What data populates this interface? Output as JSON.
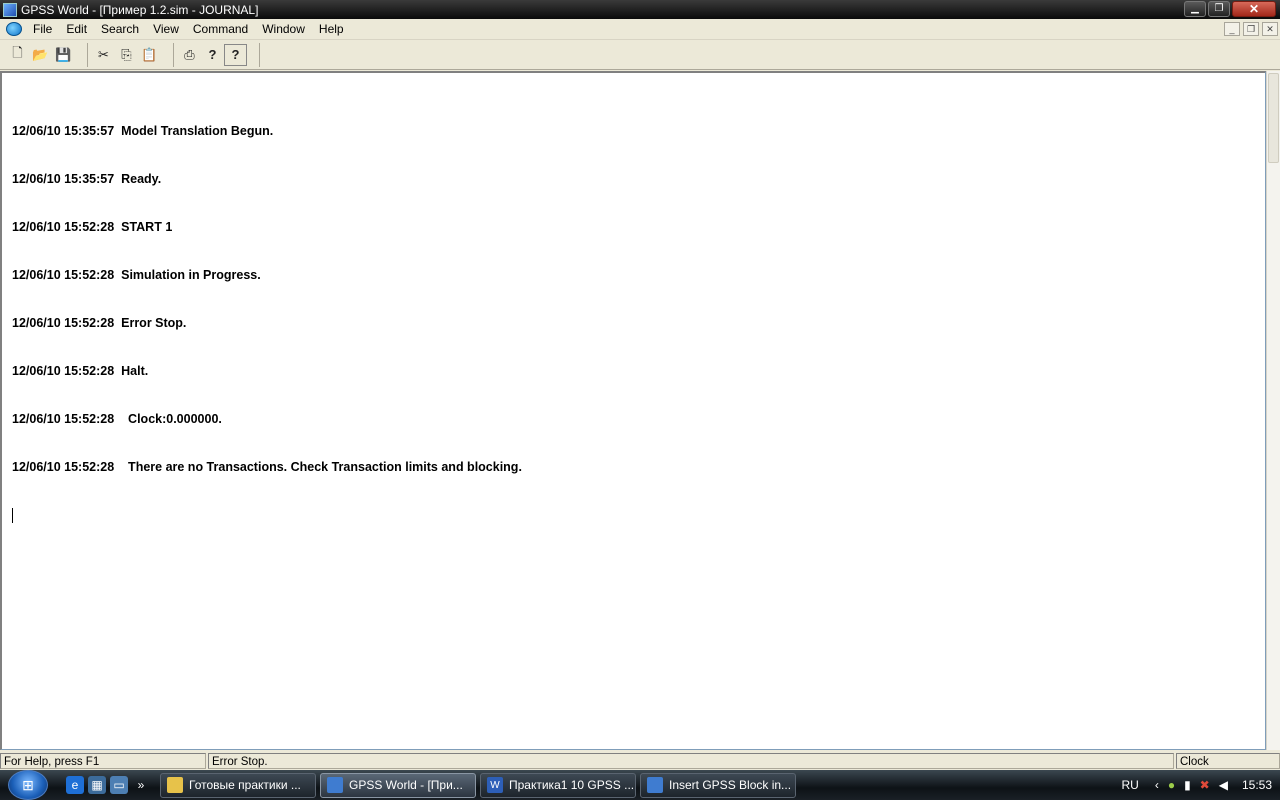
{
  "window": {
    "title": "GPSS World - [Пример 1.2.sim  -  JOURNAL]",
    "min_glyph": "▁",
    "max_glyph": "❐",
    "close_glyph": "✕"
  },
  "menu": {
    "items": [
      "File",
      "Edit",
      "Search",
      "View",
      "Command",
      "Window",
      "Help"
    ],
    "mdi_min_glyph": "_",
    "mdi_restore_glyph": "❐",
    "mdi_close_glyph": "✕"
  },
  "toolbar": {
    "icons": [
      "new-file-icon",
      "open-folder-icon",
      "save-icon",
      "cut-icon",
      "copy-icon",
      "paste-icon",
      "print-icon",
      "help-icon",
      "context-help-icon"
    ],
    "glyphs": {
      "new": "🗋",
      "open": "📂",
      "save": "💾",
      "cut": "✂",
      "copy": "⎘",
      "paste": "📋",
      "print": "⎙",
      "help": "?",
      "context_help": "?"
    }
  },
  "journal": {
    "lines": [
      "12/06/10 15:35:57  Model Translation Begun.",
      "12/06/10 15:35:57  Ready.",
      "12/06/10 15:52:28  START 1",
      "12/06/10 15:52:28  Simulation in Progress.",
      "12/06/10 15:52:28  Error Stop.",
      "12/06/10 15:52:28  Halt.",
      "12/06/10 15:52:28    Clock:0.000000.",
      "12/06/10 15:52:28    There are no Transactions. Check Transaction limits and blocking."
    ]
  },
  "status": {
    "help": "For Help, press F1",
    "message": "Error Stop.",
    "clock": "Clock"
  },
  "taskbar": {
    "start_glyph": "⊞",
    "quick_more": "»",
    "tasks": [
      {
        "label": "Готовые практики ...",
        "icon": "folder-icon"
      },
      {
        "label": "GPSS World - [При...",
        "icon": "gpss-icon"
      },
      {
        "label": "Практика1 10 GPSS ...",
        "icon": "word-icon"
      },
      {
        "label": "Insert GPSS Block in...",
        "icon": "gpss-icon"
      }
    ],
    "tray": {
      "lang": "RU",
      "chevron": "‹",
      "time": "15:53"
    }
  },
  "colors": {
    "titlebar": "#1a1a1a",
    "window_bg": "#ece9d8",
    "journal_bg": "#ffffff",
    "taskbar": "#1d242b"
  }
}
